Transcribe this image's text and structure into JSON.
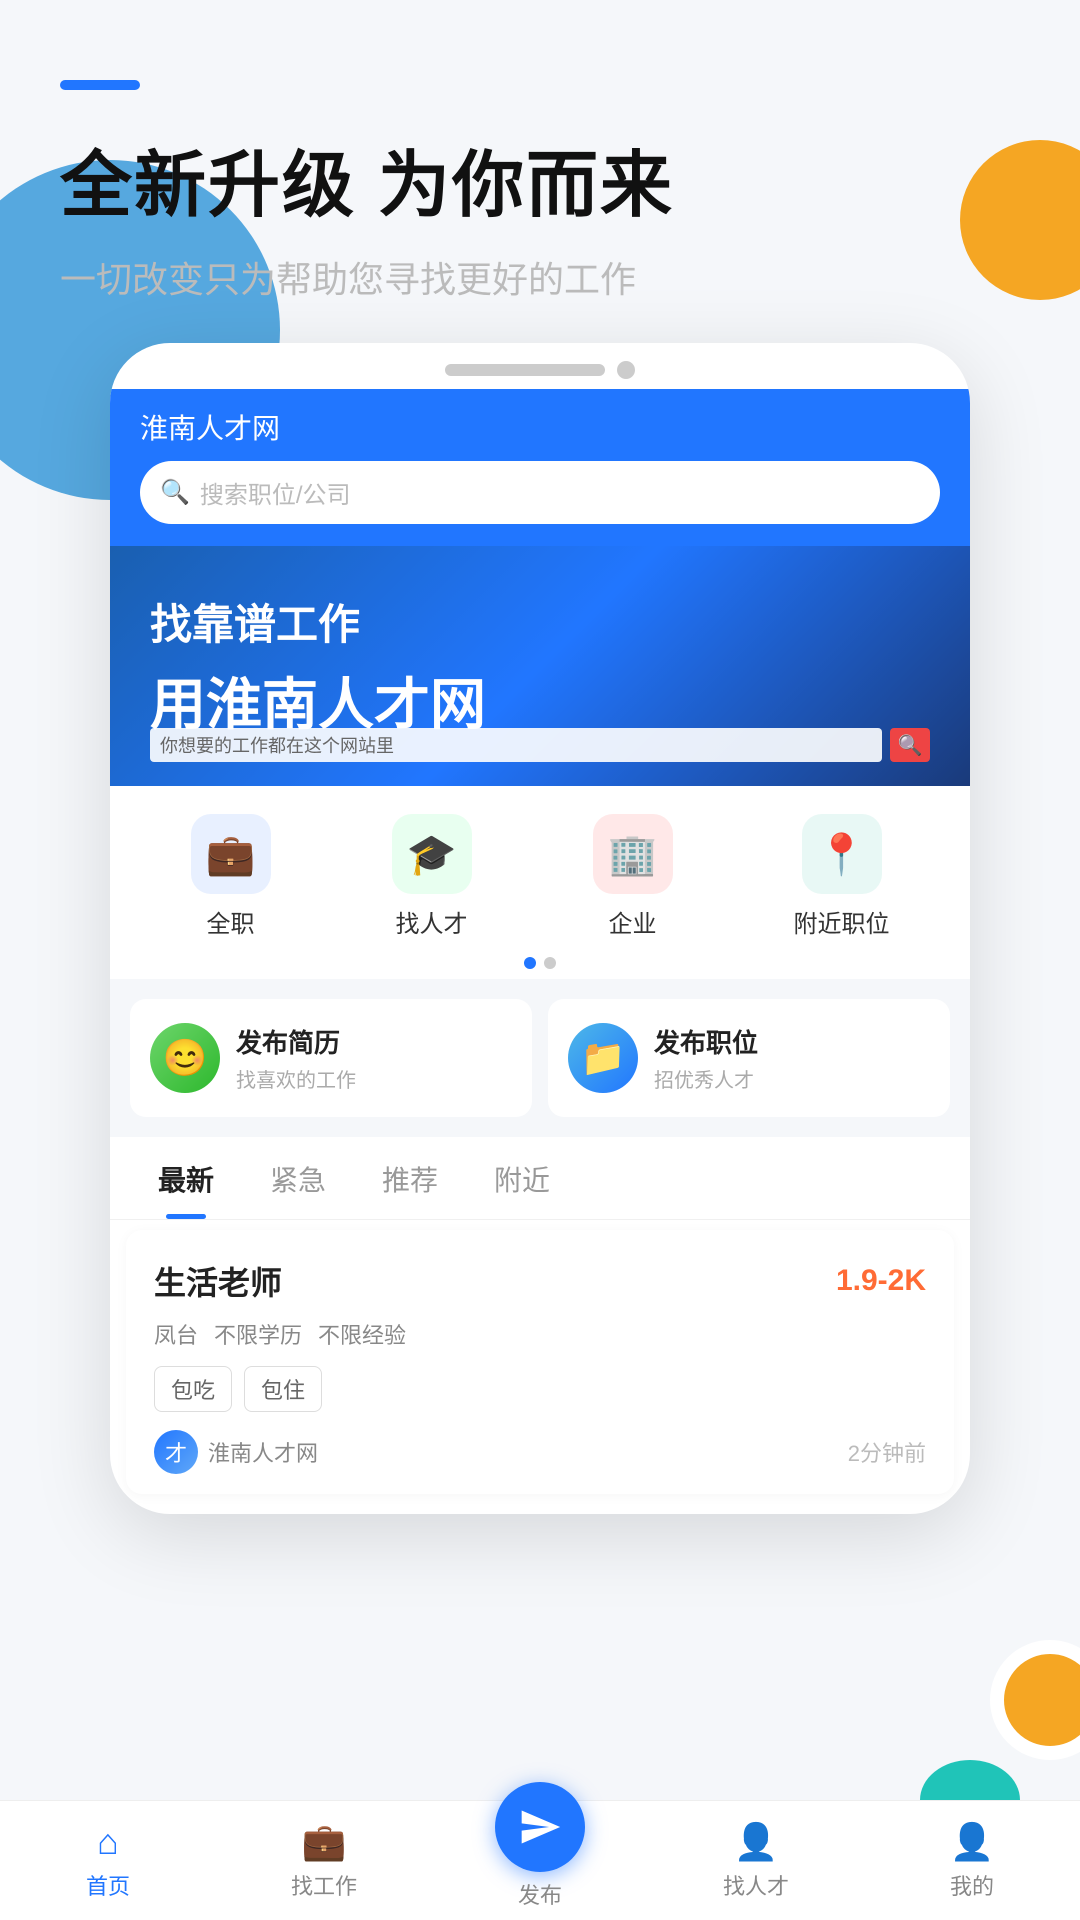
{
  "app": {
    "name": "淮南人才网"
  },
  "hero": {
    "dash": "",
    "title": "全新升级 为你而来",
    "subtitle": "一切改变只为帮助您寻找更好的工作"
  },
  "search": {
    "placeholder": "搜索职位/公司"
  },
  "banner": {
    "line1": "找靠谱工作",
    "line2": "用淮南人才网",
    "url_placeholder": "你想要的工作都在这个网站里"
  },
  "categories": [
    {
      "label": "全职",
      "color": "blue"
    },
    {
      "label": "找人才",
      "color": "green"
    },
    {
      "label": "企业",
      "color": "red"
    },
    {
      "label": "附近职位",
      "color": "teal"
    }
  ],
  "actions": [
    {
      "title": "发布简历",
      "sub": "找喜欢的工作",
      "type": "green"
    },
    {
      "title": "发布职位",
      "sub": "招优秀人才",
      "type": "blue"
    }
  ],
  "tabs": [
    {
      "label": "最新",
      "active": true
    },
    {
      "label": "紧急",
      "active": false
    },
    {
      "label": "推荐",
      "active": false
    },
    {
      "label": "附近",
      "active": false
    }
  ],
  "job": {
    "title": "生活老师",
    "salary": "1.9-2K",
    "meta": [
      "凤台",
      "不限学历",
      "不限经验"
    ],
    "tags": [
      "包吃",
      "包住"
    ],
    "company": "淮南人才网",
    "time": "2分钟前"
  },
  "nav": [
    {
      "label": "首页",
      "active": true
    },
    {
      "label": "找工作",
      "active": false
    },
    {
      "label": "发布",
      "active": false,
      "special": true
    },
    {
      "label": "找人才",
      "active": false
    },
    {
      "label": "我的",
      "active": false
    }
  ]
}
